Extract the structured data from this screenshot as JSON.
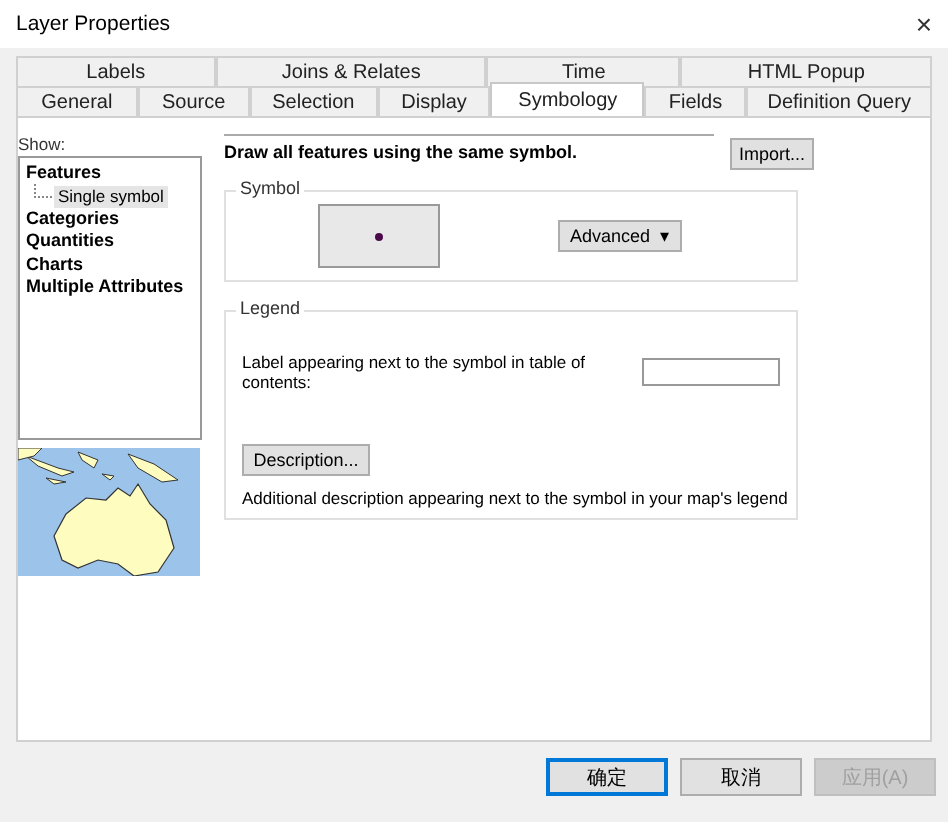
{
  "window": {
    "title": "Layer Properties",
    "close": "×"
  },
  "tabs_back": [
    {
      "label": "Labels",
      "selected": false
    },
    {
      "label": "Joins & Relates",
      "selected": false
    },
    {
      "label": "Time",
      "selected": false
    },
    {
      "label": "HTML Popup",
      "selected": false
    }
  ],
  "tabs_front": [
    {
      "label": "General",
      "selected": false
    },
    {
      "label": "Source",
      "selected": false
    },
    {
      "label": "Selection",
      "selected": false
    },
    {
      "label": "Display",
      "selected": false
    },
    {
      "label": "Symbology",
      "selected": true
    },
    {
      "label": "Fields",
      "selected": false
    },
    {
      "label": "Definition Query",
      "selected": false
    }
  ],
  "show": {
    "label": "Show:",
    "tree": [
      {
        "label": "Features",
        "selected": false,
        "children": [
          {
            "label": "Single symbol",
            "selected": true
          }
        ]
      },
      {
        "label": "Categories",
        "selected": false
      },
      {
        "label": "Quantities",
        "selected": false
      },
      {
        "label": "Charts",
        "selected": false
      },
      {
        "label": "Multiple Attributes",
        "selected": false
      }
    ]
  },
  "heading": "Draw all features using the same symbol.",
  "import_button": "Import...",
  "symbol_group": {
    "title": "Symbol",
    "advanced_button": "Advanced",
    "caret": "▾"
  },
  "legend_group": {
    "title": "Legend",
    "label_prompt": "Label appearing next to the symbol in table of contents:",
    "description_button": "Description...",
    "description_note": "Additional description appearing next to the symbol in your map's legend"
  },
  "buttons": [
    {
      "label": "确定",
      "disabled": false,
      "default": true
    },
    {
      "label": "取消",
      "disabled": false,
      "default": false
    },
    {
      "label": "应用(A)",
      "disabled": true,
      "default": false
    }
  ]
}
